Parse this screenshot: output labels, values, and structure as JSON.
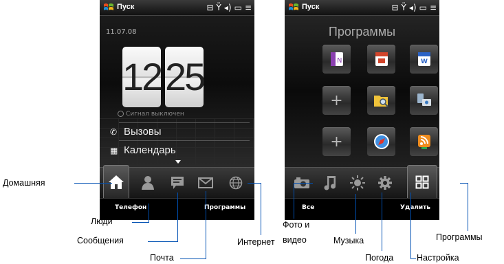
{
  "phone_home": {
    "statusbar": {
      "start_label": "Пуск"
    },
    "date": "11.07.08",
    "clock": {
      "hour": "12",
      "minute": "25"
    },
    "alarm": "Сигнал выключен",
    "rows": [
      "Вызовы",
      "Календарь"
    ],
    "softkeys": {
      "left": "Телефон",
      "right": "Программы"
    }
  },
  "phone_programs": {
    "statusbar": {
      "start_label": "Пуск"
    },
    "title": "Программы",
    "softkeys": {
      "left": "Все",
      "right": "Удалить"
    }
  },
  "callouts": {
    "home": "Домашняя",
    "people": "Люди",
    "messages": "Сообщения",
    "mail": "Почта",
    "internet": "Интернет",
    "photo_line1": "Фото и",
    "photo_line2": "видео",
    "music": "Музыка",
    "weather": "Погода",
    "settings": "Настройка",
    "programs": "Программы"
  },
  "colors": {
    "callout_line": "#0050b3",
    "screen_bg": "#000000"
  }
}
